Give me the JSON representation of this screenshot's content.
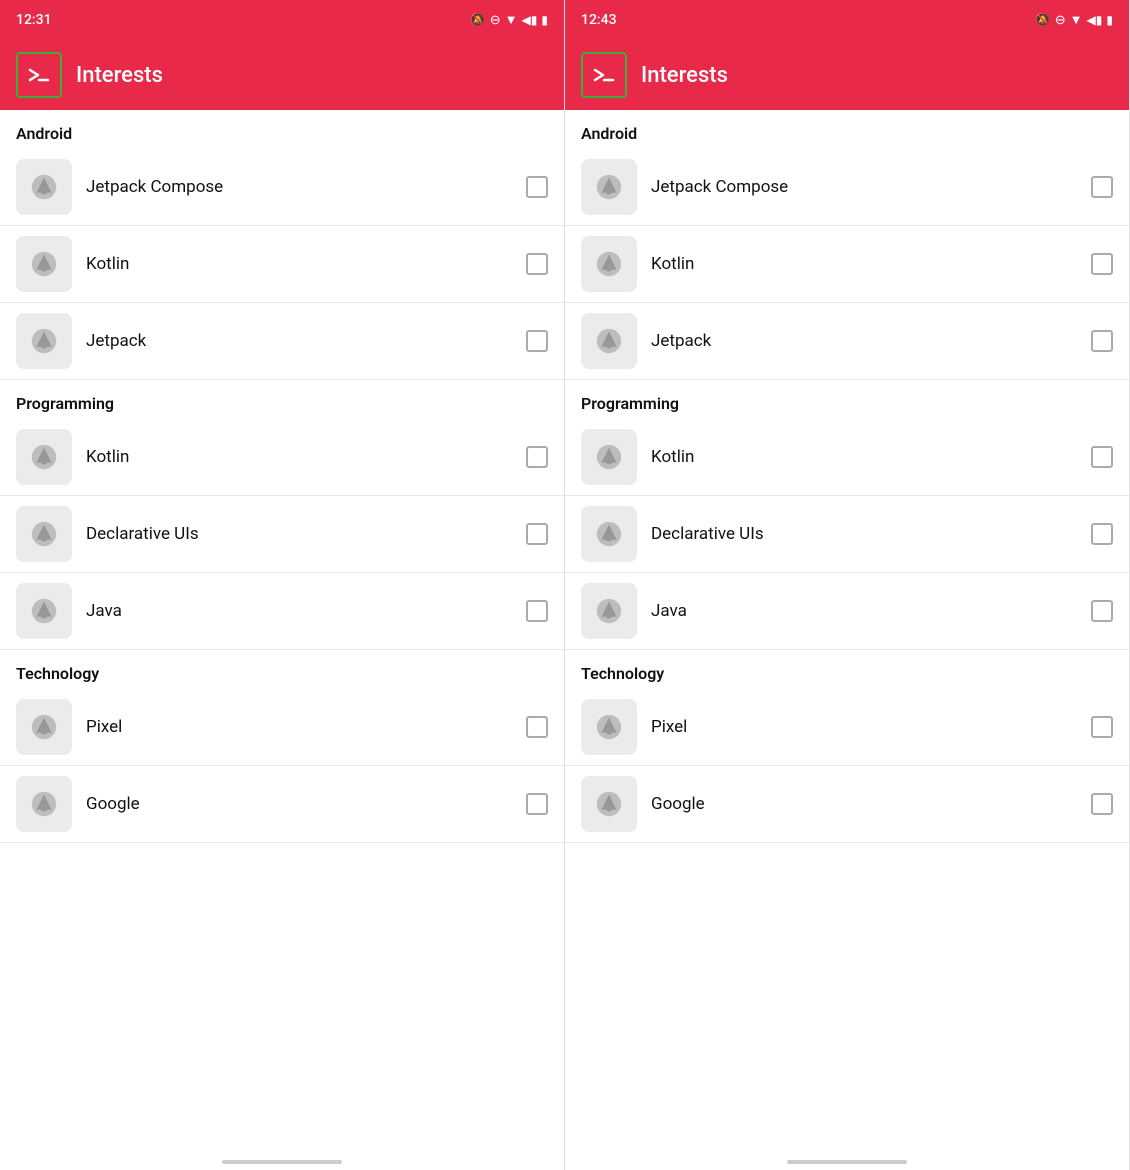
{
  "panels": [
    {
      "id": "left",
      "statusBar": {
        "time": "12:31",
        "icons": [
          "🔔̶",
          "⊖",
          "▼",
          "◀",
          "▮"
        ]
      },
      "appBar": {
        "title": "Interests",
        "iconLabel": "terminal-icon"
      },
      "sections": [
        {
          "header": "Android",
          "items": [
            {
              "label": "Jetpack Compose",
              "checked": false
            },
            {
              "label": "Kotlin",
              "checked": false
            },
            {
              "label": "Jetpack",
              "checked": false
            }
          ]
        },
        {
          "header": "Programming",
          "items": [
            {
              "label": "Kotlin",
              "checked": false
            },
            {
              "label": "Declarative UIs",
              "checked": false
            },
            {
              "label": "Java",
              "checked": false
            }
          ]
        },
        {
          "header": "Technology",
          "items": [
            {
              "label": "Pixel",
              "checked": false
            },
            {
              "label": "Google",
              "checked": false
            }
          ]
        }
      ]
    },
    {
      "id": "right",
      "statusBar": {
        "time": "12:43",
        "icons": [
          "🔔̶",
          "⊖",
          "▼",
          "◀",
          "▮"
        ]
      },
      "appBar": {
        "title": "Interests",
        "iconLabel": "terminal-icon"
      },
      "sections": [
        {
          "header": "Android",
          "items": [
            {
              "label": "Jetpack Compose",
              "checked": false
            },
            {
              "label": "Kotlin",
              "checked": false
            },
            {
              "label": "Jetpack",
              "checked": false
            }
          ]
        },
        {
          "header": "Programming",
          "items": [
            {
              "label": "Kotlin",
              "checked": false
            },
            {
              "label": "Declarative UIs",
              "checked": false
            },
            {
              "label": "Java",
              "checked": false
            }
          ]
        },
        {
          "header": "Technology",
          "items": [
            {
              "label": "Pixel",
              "checked": false
            },
            {
              "label": "Google",
              "checked": false
            }
          ]
        }
      ]
    }
  ],
  "colors": {
    "appBar": "#e8294a",
    "iconBorder": "#3aaf3a"
  }
}
